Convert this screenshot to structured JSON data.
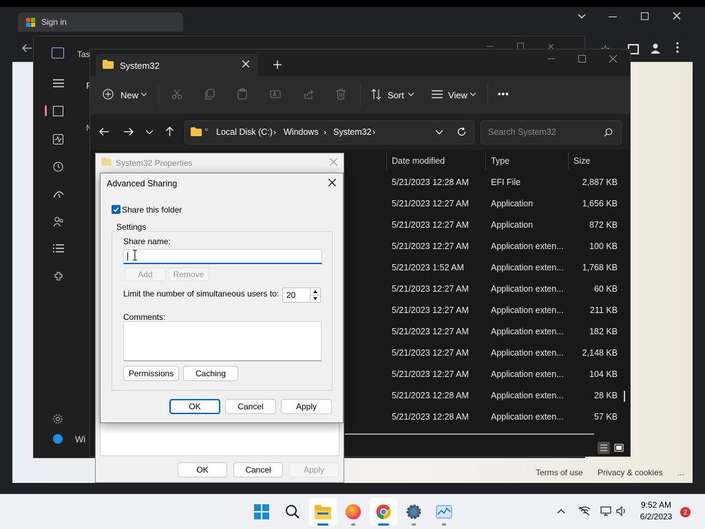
{
  "browser": {
    "tab_title": "Sign in",
    "footer_links": [
      "Terms of use",
      "Privacy & cookies",
      "..."
    ]
  },
  "taskmgr": {
    "title": "Tas",
    "partial_label_1": "F",
    "partial_label_2": "N",
    "bottom_text": "Wi"
  },
  "explorer": {
    "tab_title": "System32",
    "new_label": "New",
    "sort_label": "Sort",
    "view_label": "View",
    "more_label": "•••",
    "address": {
      "overflow": "«",
      "crumbs": [
        "Local Disk (C:)",
        "Windows",
        "System32"
      ]
    },
    "search_placeholder": "Search System32",
    "columns": [
      "Date modified",
      "Type",
      "Size"
    ],
    "rows": [
      {
        "date": "5/21/2023 12:28 AM",
        "type": "EFI File",
        "size": "2,887 KB"
      },
      {
        "date": "5/21/2023 12:27 AM",
        "type": "Application",
        "size": "1,656 KB"
      },
      {
        "date": "5/21/2023 12:27 AM",
        "type": "Application",
        "size": "872 KB"
      },
      {
        "date": "5/21/2023 12:27 AM",
        "type": "Application exten...",
        "size": "100 KB"
      },
      {
        "date": "5/21/2023 1:52 AM",
        "type": "Application exten...",
        "size": "1,768 KB"
      },
      {
        "date": "5/21/2023 12:27 AM",
        "type": "Application exten...",
        "size": "60 KB"
      },
      {
        "date": "5/21/2023 12:27 AM",
        "type": "Application exten...",
        "size": "211 KB"
      },
      {
        "date": "5/21/2023 12:27 AM",
        "type": "Application exten...",
        "size": "182 KB"
      },
      {
        "date": "5/21/2023 12:27 AM",
        "type": "Application exten...",
        "size": "2,148 KB"
      },
      {
        "date": "5/21/2023 12:27 AM",
        "type": "Application exten...",
        "size": "104 KB"
      },
      {
        "date": "5/21/2023 12:28 AM",
        "type": "Application exten...",
        "size": "28 KB"
      },
      {
        "date": "5/21/2023 12:28 AM",
        "type": "Application exten...",
        "size": "57 KB"
      }
    ]
  },
  "properties": {
    "title": "System32 Properties",
    "ok": "OK",
    "cancel": "Cancel",
    "apply": "Apply"
  },
  "advanced_sharing": {
    "title": "Advanced Sharing",
    "share_checkbox": "Share this folder",
    "share_checked": true,
    "settings_label": "Settings",
    "share_name_label": "Share name:",
    "share_name_value": "",
    "add": "Add",
    "remove": "Remove",
    "limit_label": "Limit the number of simultaneous users to:",
    "limit_value": "20",
    "comments_label": "Comments:",
    "comments_value": "",
    "permissions": "Permissions",
    "caching": "Caching",
    "ok": "OK",
    "cancel": "Cancel",
    "apply": "Apply"
  },
  "taskbar": {
    "time": "9:52 AM",
    "date": "6/2/2023",
    "notification_count": "2",
    "apps": [
      "start-icon",
      "search-icon",
      "file-explorer-icon",
      "firefox-icon",
      "chrome-icon",
      "settings-icon",
      "task-manager-icon"
    ]
  },
  "colors": {
    "accent": "#0067c0",
    "explorer_bg": "#191919",
    "taskbar_bg": "#eef0f4"
  }
}
